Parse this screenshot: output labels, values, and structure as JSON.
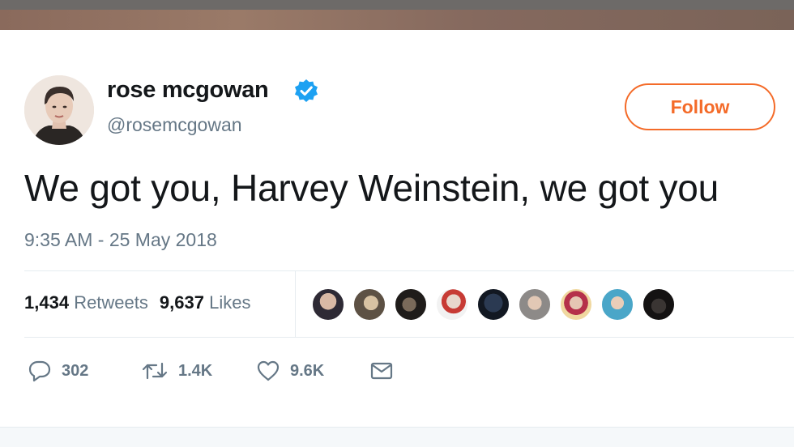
{
  "tweet": {
    "author": {
      "name": "rose mcgowan",
      "handle": "@rosemcgowan",
      "verified": true
    },
    "follow_label": "Follow",
    "text": "We got you, Harvey Weinstein, we got you",
    "timestamp": "9:35 AM - 25 May 2018",
    "stats": {
      "retweets_count": "1,434",
      "retweets_label": "Retweets",
      "likes_count": "9,637",
      "likes_label": "Likes"
    },
    "actions": {
      "reply_count": "302",
      "retweet_count": "1.4K",
      "like_count": "9.6K"
    },
    "liker_avatars": [
      "liker-1",
      "liker-2",
      "liker-3",
      "liker-4",
      "liker-5",
      "liker-6",
      "liker-7",
      "liker-8",
      "liker-9"
    ]
  },
  "colors": {
    "accent": "#f46b29",
    "verified": "#1da1f2",
    "secondary_text": "#657786",
    "divider": "#e6ecf0"
  },
  "icons": {
    "reply": "speech-bubble-icon",
    "retweet": "retweet-arrows-icon",
    "like": "heart-icon",
    "dm": "envelope-icon",
    "verified": "verified-badge-icon"
  }
}
